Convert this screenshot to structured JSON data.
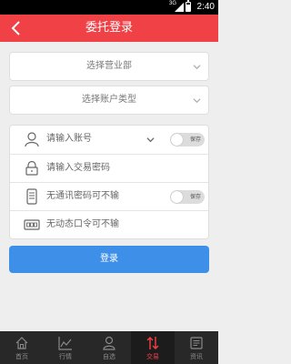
{
  "status_bar": {
    "network": "3G",
    "time": "2:40"
  },
  "header": {
    "title": "委托登录"
  },
  "selects": {
    "branch_placeholder": "选择营业部",
    "account_type_placeholder": "选择账户类型"
  },
  "form": {
    "account_placeholder": "请输入账号",
    "account_save_label": "保存",
    "trade_password_placeholder": "请输入交易密码",
    "comm_password_text": "无通讯密码可不输",
    "comm_save_label": "保存",
    "dynamic_password_text": "无动态口令可不输"
  },
  "login_button": "登录",
  "tabs": [
    {
      "label": "首页",
      "icon": "home-icon"
    },
    {
      "label": "行情",
      "icon": "chart-line-icon"
    },
    {
      "label": "自选",
      "icon": "user-icon"
    },
    {
      "label": "交易",
      "icon": "trade-arrows-icon",
      "active": true
    },
    {
      "label": "资讯",
      "icon": "news-icon"
    }
  ],
  "colors": {
    "accent": "#ef4146",
    "button": "#3d8fe8",
    "tabbar": "#282828",
    "background": "#eeeeee"
  }
}
